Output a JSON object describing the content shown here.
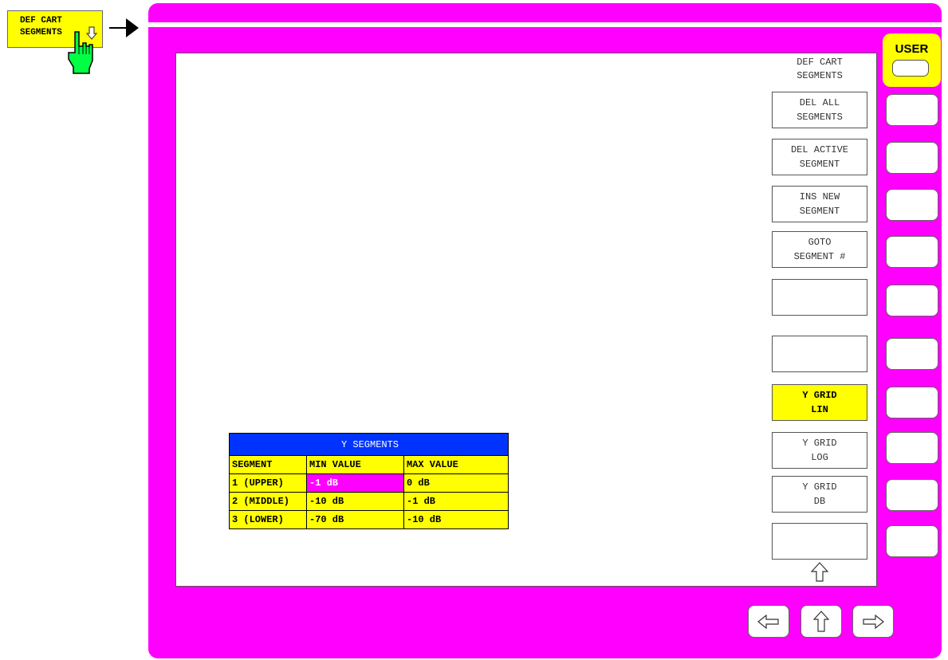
{
  "menu_key": {
    "line1": "DEF CART",
    "line2": "SEGMENTS"
  },
  "side_menu": {
    "title_line1": "DEF CART",
    "title_line2": "SEGMENTS",
    "softkeys": [
      {
        "line1": "DEL ALL",
        "line2": "SEGMENTS"
      },
      {
        "line1": "DEL ACTIVE",
        "line2": "SEGMENT"
      },
      {
        "line1": "INS NEW",
        "line2": "SEGMENT"
      },
      {
        "line1": "GOTO",
        "line2": "SEGMENT #"
      },
      {
        "line1": "",
        "line2": ""
      },
      {
        "line1": "",
        "line2": ""
      },
      {
        "line1": "Y GRID",
        "line2": "LIN",
        "active": true
      },
      {
        "line1": "Y GRID",
        "line2": "LOG"
      },
      {
        "line1": "Y GRID",
        "line2": "DB"
      },
      {
        "line1": "",
        "line2": ""
      }
    ]
  },
  "hardkeys": {
    "user_label": "USER"
  },
  "y_segments": {
    "title": "Y SEGMENTS",
    "headers": [
      "SEGMENT",
      "MIN VALUE",
      "MAX VALUE"
    ],
    "rows": [
      {
        "segment": "1 (UPPER)",
        "min": "-1 dB",
        "max": "0 dB"
      },
      {
        "segment": "2 (MIDDLE)",
        "min": "-10 dB",
        "max": "-1 dB"
      },
      {
        "segment": "3 (LOWER)",
        "min": "-70 dB",
        "max": "-10 dB"
      }
    ]
  },
  "icons": {
    "hand": "pointing-hand-icon",
    "right_arrow": "right-arrow-icon",
    "more": "up-outline-arrow-icon",
    "nav_left": "left-outline-arrow-icon",
    "nav_up": "up-outline-arrow-icon",
    "nav_right": "right-outline-arrow-icon"
  },
  "colors": {
    "frame": "#ff00ff",
    "active_softkey": "#ffff00",
    "table_title": "#0033ff",
    "table_cells": "#ffff00",
    "active_cell": "#ff00ff"
  }
}
